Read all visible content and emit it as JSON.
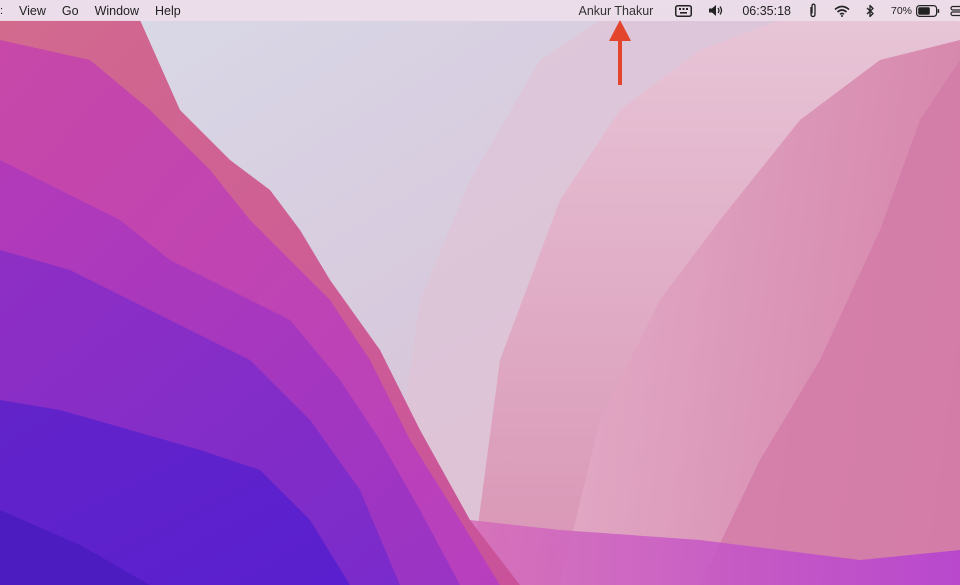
{
  "menubar": {
    "items": [
      {
        "label": "View"
      },
      {
        "label": "Go"
      },
      {
        "label": "Window"
      },
      {
        "label": "Help"
      }
    ],
    "status": {
      "user_name": "Ankur Thakur",
      "time": "06:35:18",
      "battery_percent": "70%",
      "battery_level": 0.7,
      "icons": [
        "keyboard-brightness-icon",
        "volume-icon",
        "clipboard-icon",
        "wifi-icon",
        "bluetooth-icon",
        "battery-icon",
        "control-center-icon"
      ]
    }
  },
  "annotation": {
    "arrow_color": "#e2442c",
    "points_to": "user-name"
  },
  "wallpaper": {
    "colors": [
      "#d6d3e6",
      "#c94bb3",
      "#9b3fc9",
      "#5a1fcf",
      "#e89ab8",
      "#d97aa8"
    ]
  }
}
